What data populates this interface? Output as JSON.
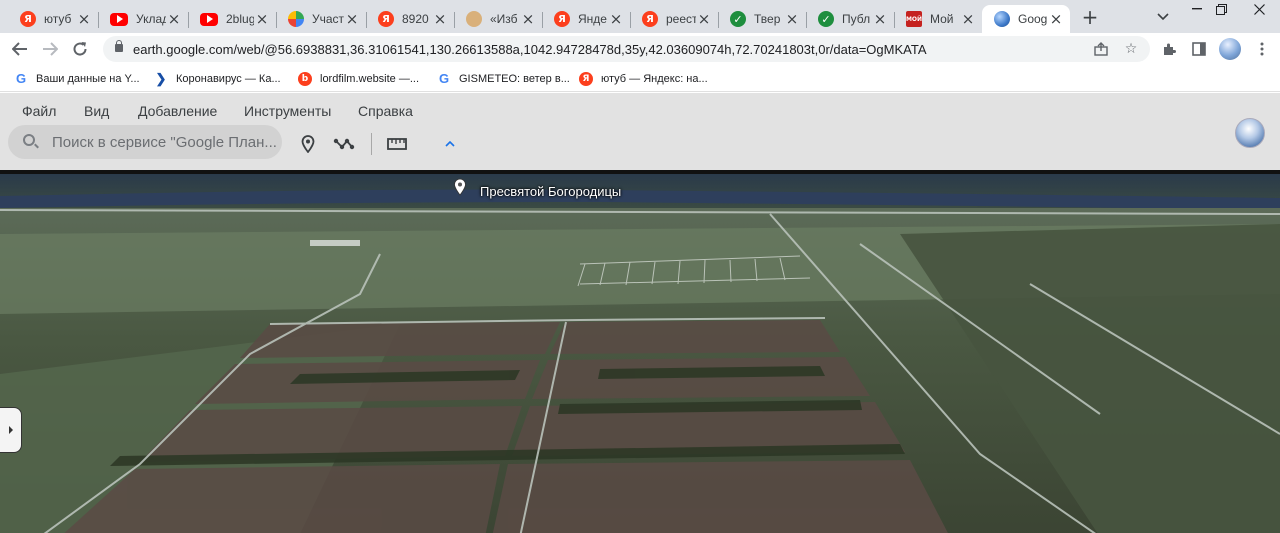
{
  "tabs": [
    {
      "title": "ютуб",
      "icon": "yandex-icon"
    },
    {
      "title": "Уклад",
      "icon": "youtube-icon"
    },
    {
      "title": "2blug",
      "icon": "youtube-icon"
    },
    {
      "title": "Участ",
      "icon": "app-icon"
    },
    {
      "title": "8920",
      "icon": "yandex-icon"
    },
    {
      "title": "«Изб",
      "icon": "cookie-icon"
    },
    {
      "title": "Янде",
      "icon": "yandex-icon"
    },
    {
      "title": "реест",
      "icon": "yandex-icon"
    },
    {
      "title": "Твер",
      "icon": "check-icon"
    },
    {
      "title": "Публ",
      "icon": "check-icon"
    },
    {
      "title": "Мой",
      "icon": "moi-icon"
    },
    {
      "title": "Goog",
      "icon": "google-earth-icon",
      "active": true
    }
  ],
  "address_bar": {
    "url": "earth.google.com/web/@56.6938831,36.31061541,130.26613588a,1042.94728478d,35y,42.03609074h,72.70241803t,0r/data=OgMKATA"
  },
  "bookmarks": [
    {
      "title": "Ваши данные на Y...",
      "icon": "google-icon"
    },
    {
      "title": "Коронавирус — Ка...",
      "icon": "arrow-icon"
    },
    {
      "title": "lordfilm.website —...",
      "icon": "lordfilm-icon"
    },
    {
      "title": "GISMETEO: ветер в...",
      "icon": "google-icon"
    },
    {
      "title": "ютуб — Яндекс: на...",
      "icon": "yandex-icon"
    }
  ],
  "earth": {
    "menu": [
      "Файл",
      "Вид",
      "Добавление",
      "Инструменты",
      "Справка"
    ],
    "search_placeholder": "Поиск в сервисе \"Google План...",
    "place_label": "Пресвятой Богородицы"
  },
  "colors": {
    "tabstrip": "#dee1e6",
    "earth_header": "#e2e2e2",
    "yandex": "#fc3f1d",
    "youtube": "#ff0000",
    "accent": "#1a73e8"
  }
}
